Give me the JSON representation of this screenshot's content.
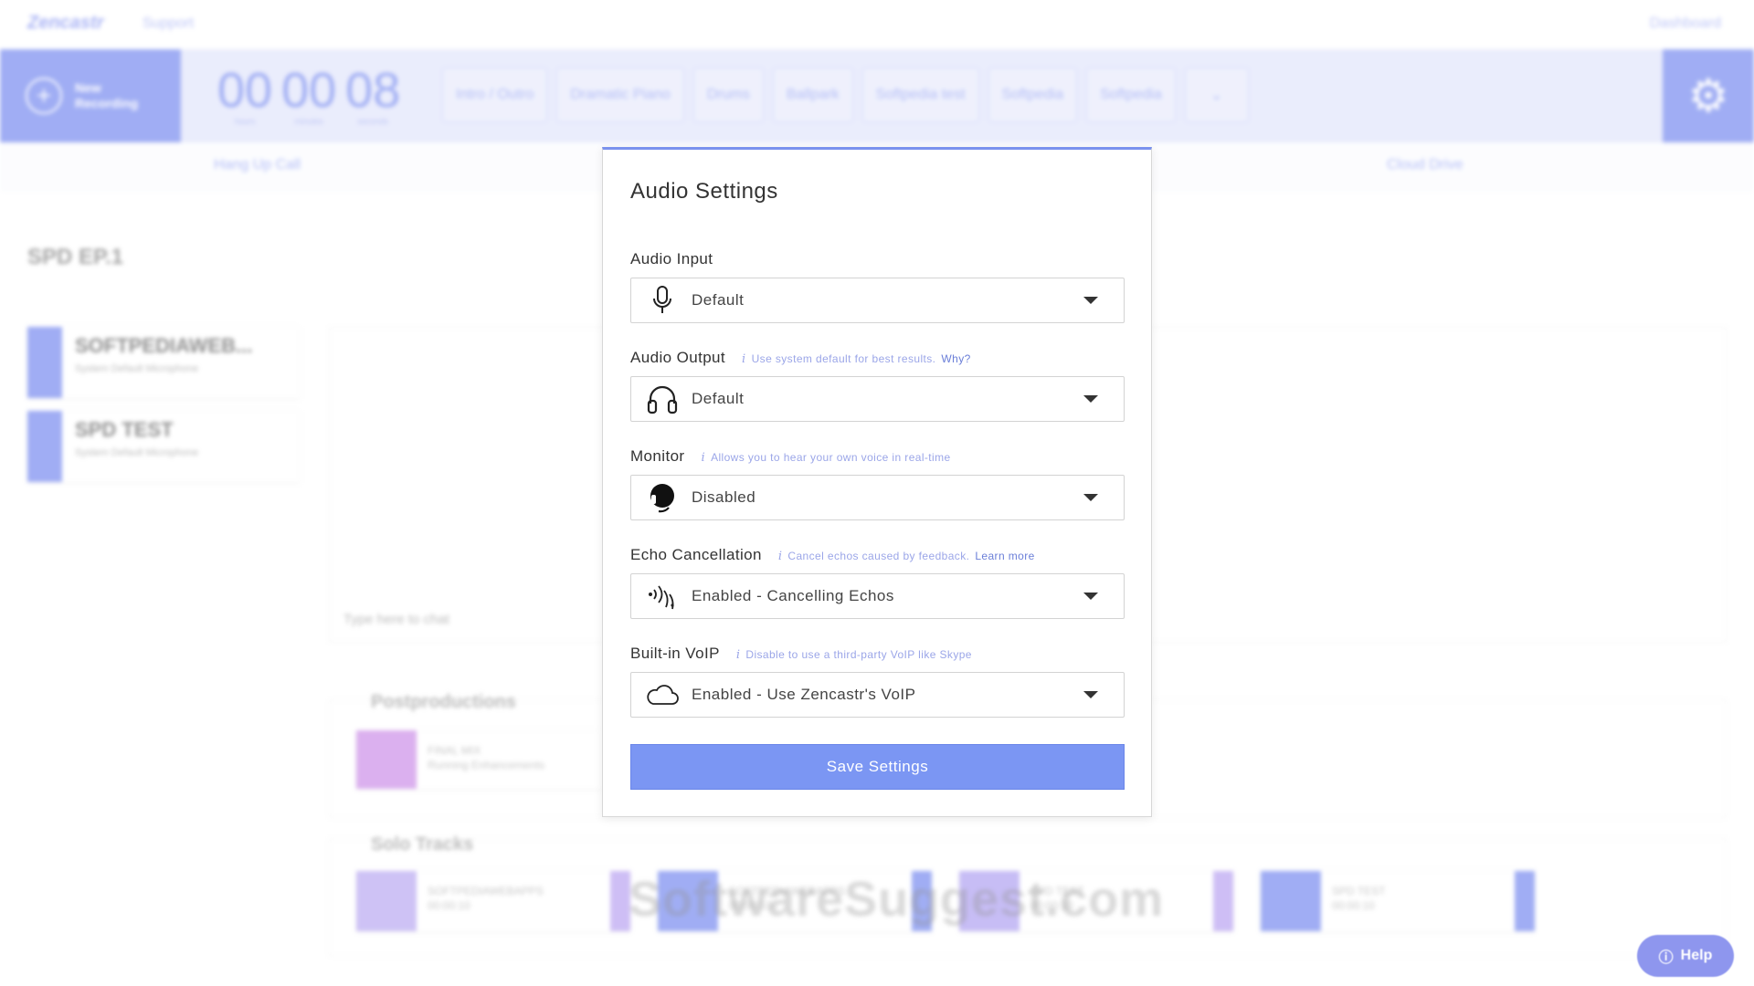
{
  "topnav": {
    "brand": "Zencastr",
    "support": "Support",
    "dashboard": "Dashboard"
  },
  "toolbar": {
    "new_recording": "New Recording",
    "timer": [
      {
        "value": "00",
        "unit": "hours"
      },
      {
        "value": "00",
        "unit": "minutes"
      },
      {
        "value": "08",
        "unit": "seconds"
      }
    ],
    "clips": [
      "Intro / Outro",
      "Dramatic Piano",
      "Drums",
      "Ballpark",
      "Softpedia test",
      "Softpedia",
      "Softpedia"
    ]
  },
  "subbar": {
    "hang_up": "Hang Up Call",
    "cloud_drive": "Cloud Drive"
  },
  "episode": {
    "title": "SPD EP.1"
  },
  "users": [
    {
      "name": "SOFTPEDIAWEB...",
      "sub": "System Default Microphone"
    },
    {
      "name": "SPD TEST",
      "sub": "System Default Microphone"
    }
  ],
  "chat": {
    "placeholder": "Type here to chat"
  },
  "postproductions": {
    "title": "Postproductions",
    "item_name": "FINAL MIX",
    "item_status": "Running Enhancements"
  },
  "solo_tracks": {
    "title": "Solo Tracks",
    "items": [
      {
        "name": "SOFTPEDIAWEBAPPS",
        "time": "00:00:10"
      },
      {
        "name": "SOFTPEDIAWEBAPPS",
        "time": "00:00:10"
      },
      {
        "name": "SPD TEST",
        "time": "00:00:10"
      },
      {
        "name": "SPD TEST",
        "time": "00:00:10"
      }
    ]
  },
  "watermarks": {
    "mid": "SOFTPEDIA",
    "bottom": "SoftwareSuggest.com"
  },
  "help": {
    "label": "Help"
  },
  "modal": {
    "title": "Audio Settings",
    "audio_input": {
      "label": "Audio Input",
      "value": "Default",
      "icon": "microphone-icon"
    },
    "audio_output": {
      "label": "Audio Output",
      "hint": "Use system default for best results.",
      "hint_link": "Why?",
      "value": "Default",
      "icon": "headphones-icon"
    },
    "monitor": {
      "label": "Monitor",
      "hint": "Allows you to hear your own voice in real-time",
      "value": "Disabled",
      "icon": "headset-icon"
    },
    "echo_cancellation": {
      "label": "Echo Cancellation",
      "hint": "Cancel echos caused by feedback.",
      "hint_link": "Learn more",
      "value": "Enabled - Cancelling Echos",
      "icon": "echo-waves-icon"
    },
    "voip": {
      "label": "Built-in VoIP",
      "hint": "Disable to use a third-party VoIP like Skype",
      "value": "Enabled - Use Zencastr's VoIP",
      "icon": "cloud-icon"
    },
    "save_label": "Save Settings",
    "accent": "#7b96f3"
  }
}
